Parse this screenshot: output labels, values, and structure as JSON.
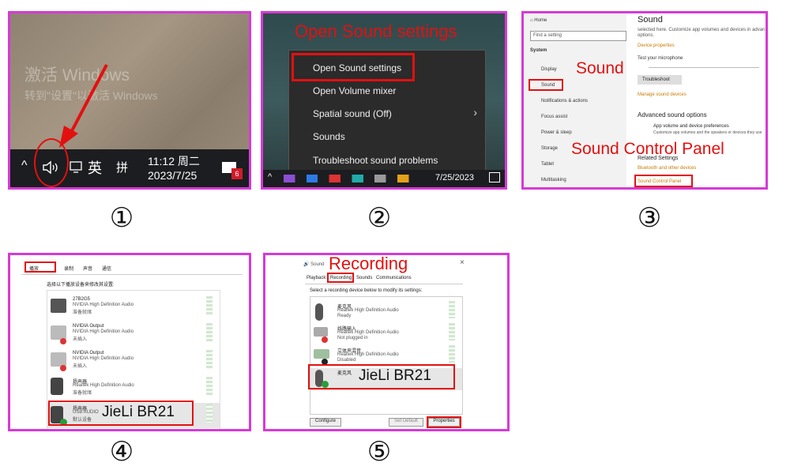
{
  "steps": [
    "①",
    "②",
    "③",
    "④",
    "⑤"
  ],
  "panel1": {
    "watermark1": "激活 Windows",
    "watermark2": "转到\"设置\"以激活 Windows",
    "tray_chevron": "^",
    "lang": "英",
    "ime": "拼",
    "time": "11:12 周二",
    "date": "2023/7/25",
    "notif_count": "6"
  },
  "panel2": {
    "heading": "Open Sound settings",
    "menu": [
      "Open Sound settings",
      "Open Volume mixer",
      "Spatial sound (Off)",
      "Sounds",
      "Troubleshoot sound problems"
    ],
    "date": "7/25/2023"
  },
  "panel3": {
    "nav": {
      "home": "Home",
      "find": "Find a setting",
      "system": "System",
      "display": "Display",
      "sound": "Sound",
      "notifications": "Notifications & actions",
      "focus": "Focus assist",
      "power": "Power & sleep",
      "storage": "Storage",
      "tablet": "Tablet",
      "multitasking": "Multitasking"
    },
    "title": "Sound",
    "line1": "selected here. Customize app volumes and devices in advan",
    "line2": "options.",
    "device_props": "Device properties",
    "test_mic": "Test your microphone",
    "troubleshoot": "Troubleshoot",
    "manage": "Manage sound devices",
    "adv_title": "Advanced sound options",
    "adv_item": "App volume and device preferences",
    "adv_desc": "Customize app volumes and the speakers or devices they use",
    "related": "Related Settings",
    "bluetooth": "Bluetooth and other devices",
    "control_panel": "Sound Control Panel",
    "label_sound": "Sound",
    "label_cp": "Sound Control Panel"
  },
  "panel4": {
    "tabs": [
      "播放",
      "录制",
      "声音",
      "通信"
    ],
    "instruction": "选择以下播放设备来修改其设置:",
    "devices": [
      {
        "name": "27B2G5",
        "driver": "NVIDIA High Definition Audio",
        "status": "准备就绪"
      },
      {
        "name": "NVIDIA Output",
        "driver": "NVIDIA High Definition Audio",
        "status": "未插入"
      },
      {
        "name": "NVIDIA Output",
        "driver": "NVIDIA High Definition Audio",
        "status": "未插入"
      },
      {
        "name": "扬声器",
        "driver": "Realtek High Definition Audio",
        "status": "准备就绪"
      },
      {
        "name": "扬声器",
        "driver": "USB AUDIO",
        "status": "默认设备"
      }
    ],
    "label": "JieLi BR21"
  },
  "panel5": {
    "window_title": "Sound",
    "close": "×",
    "heading": "Recording",
    "tabs": [
      "Playback",
      "Recording",
      "Sounds",
      "Communications"
    ],
    "instruction": "Select a recording device below to modify its settings:",
    "devices": [
      {
        "name": "麦克风",
        "driver": "Realtek High Definition Audio",
        "status": "Ready"
      },
      {
        "name": "线路输入",
        "driver": "Realtek High Definition Audio",
        "status": "Not plugged in"
      },
      {
        "name": "立体声混音",
        "driver": "Realtek High Definition Audio",
        "status": "Disabled"
      },
      {
        "name": "麦克风",
        "driver": "",
        "status": ""
      }
    ],
    "label": "JieLi BR21",
    "configure": "Configure",
    "set_default": "Set Default",
    "properties": "Properties"
  },
  "colors": {
    "border": "#d63ad6",
    "annotation": "#e31010"
  }
}
